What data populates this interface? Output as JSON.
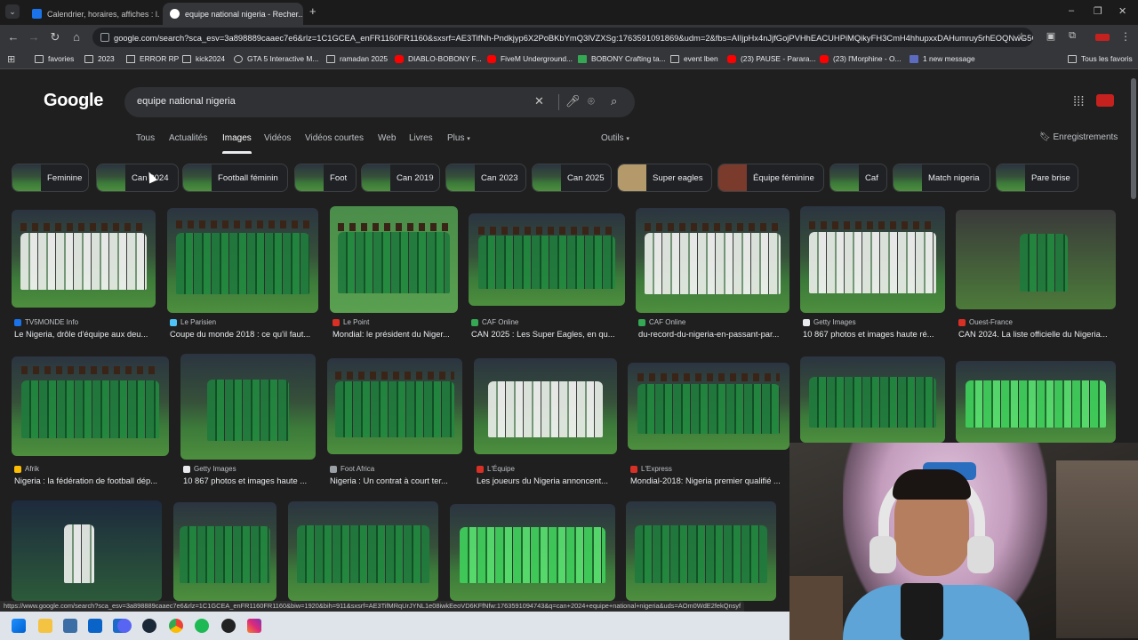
{
  "browser": {
    "tabs": [
      {
        "title": "Calendrier, horaires, affiches : l...",
        "active": false,
        "favicon_color": "#1a73e8"
      },
      {
        "title": "equipe national nigeria - Recher...",
        "active": true,
        "favicon_color": "#ffffff"
      }
    ],
    "new_tab_label": "+",
    "url": "google.com/search?sca_esv=3a898889caaec7e6&rlz=1C1GCEA_enFR1160FR1160&sxsrf=AE3TifNh-Pndkjyp6X2PoBKbYmQ3lVZXSg:1763591091869&udm=2&fbs=AIIjpHx4nJjfGojPVHhEACUHPiMQikyFH3CmH4hhupxxDAHumruy5rhEOQNwG5CK...",
    "bookmarks": [
      {
        "label": "favories",
        "type": "folder"
      },
      {
        "label": "2023",
        "type": "folder"
      },
      {
        "label": "ERROR RP",
        "type": "page"
      },
      {
        "label": "kick2024",
        "type": "folder"
      },
      {
        "label": "GTA 5 Interactive M...",
        "type": "globe"
      },
      {
        "label": "ramadan 2025",
        "type": "folder"
      },
      {
        "label": "DIABLO-BOBONY F...",
        "type": "youtube"
      },
      {
        "label": "FiveM Underground...",
        "type": "youtube"
      },
      {
        "label": "BOBONY Crafting ta...",
        "type": "sheet"
      },
      {
        "label": "event lben",
        "type": "folder"
      },
      {
        "label": "(23) PAUSE - Parara...",
        "type": "youtube"
      },
      {
        "label": "(23) l'Morphine - O...",
        "type": "youtube"
      },
      {
        "label": "1 new message",
        "type": "mail"
      }
    ],
    "all_bookmarks_label": "Tous les favoris",
    "status_url": "https://www.google.com/search?sca_esv=3a898889caaec7e6&rlz=1C1GCEA_enFR1160FR1160&biw=1920&bih=911&sxsrf=AE3TifMRqUrJYNL1e08iwkEeoVD6KFfNfw:1763591094743&q=can+2024+equipe+national+nigeria&uds=AOm0WdE2fekQnsyf"
  },
  "google": {
    "logo": "Google",
    "query": "equipe national nigeria",
    "nav_tabs": [
      "Tous",
      "Actualités",
      "Images",
      "Vidéos",
      "Vidéos courtes",
      "Web",
      "Livres",
      "Plus"
    ],
    "active_tab": "Images",
    "tools_label": "Outils",
    "saves_label": "Enregistrements",
    "chips": [
      "Feminine",
      "Can 2024",
      "Football féminin",
      "Foot",
      "Can 2019",
      "Can 2023",
      "Can 2025",
      "Super eagles",
      "Équipe féminine",
      "Caf",
      "Match nigeria",
      "Pare brise"
    ],
    "results": [
      {
        "source": "TV5MONDE Info",
        "title": "Le Nigeria, drôle d'équipe aux deu...",
        "color": "#1a73e8"
      },
      {
        "source": "Le Parisien",
        "title": "Coupe du monde 2018 : ce qu'il faut...",
        "color": "#4fc3f7"
      },
      {
        "source": "Le Point",
        "title": "Mondial: le président du Niger...",
        "color": "#d93025"
      },
      {
        "source": "CAF Online",
        "title": "CAN 2025 : Les Super Eagles, en qu...",
        "color": "#34a853"
      },
      {
        "source": "CAF Online",
        "title": "du-record-du-nigeria-en-passant-par...",
        "color": "#34a853"
      },
      {
        "source": "Getty Images",
        "title": "10 867 photos et images haute ré...",
        "color": "#e8eaed"
      },
      {
        "source": "Ouest-France",
        "title": "CAN 2024. La liste officielle du Nigeria...",
        "color": "#d93025"
      },
      {
        "source": "Afrik",
        "title": "Nigeria : la fédération de football dép...",
        "color": "#fbbc04"
      },
      {
        "source": "Getty Images",
        "title": "10 867 photos et images haute ...",
        "color": "#e8eaed"
      },
      {
        "source": "Foot Africa",
        "title": "Nigeria : Un contrat à court ter...",
        "color": "#9aa0a6"
      },
      {
        "source": "L'Équipe",
        "title": "Les joueurs du Nigeria annoncent...",
        "color": "#d93025"
      },
      {
        "source": "L'Express",
        "title": "Mondial-2018: Nigeria premier qualifié ...",
        "color": "#d93025"
      }
    ]
  }
}
